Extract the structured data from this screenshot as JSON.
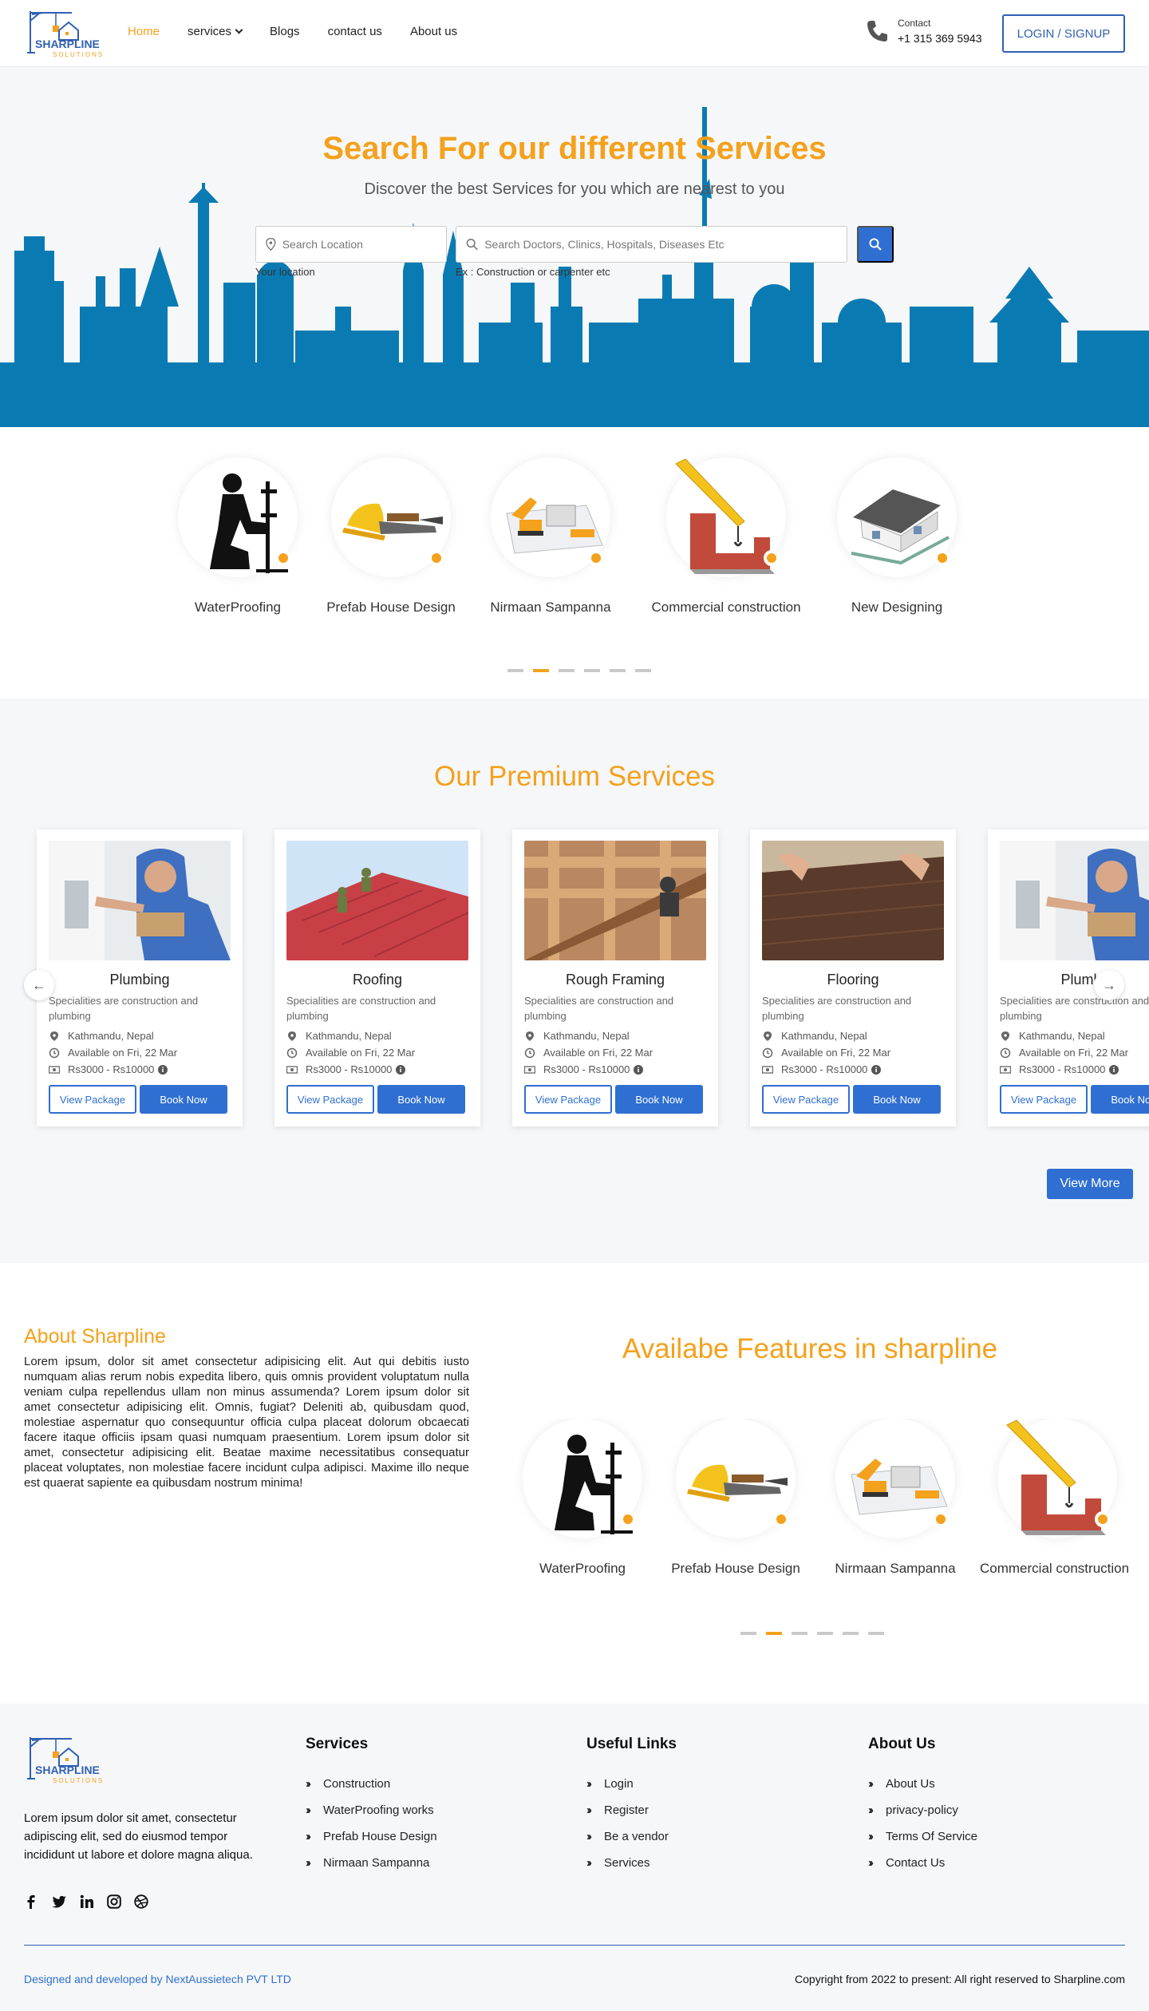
{
  "header": {
    "logo_text": "SHARPLINE",
    "logo_sub": "SOLUTIONS",
    "nav": [
      "Home",
      "services",
      "Blogs",
      "contact us",
      "About us"
    ],
    "contact_label": "Contact",
    "contact_number": "+1 315 369 5943",
    "login_label": "LOGIN / SIGNUP"
  },
  "hero": {
    "title": "Search For our different Services",
    "subtitle": "Discover the best Services for you which are nearest to you",
    "location_placeholder": "Search Location",
    "service_placeholder": "Search Doctors, Clinics, Hospitals, Diseases Etc",
    "location_hint": "Your location",
    "service_hint": "Ex : Construction or carpenter etc",
    "skyline_color": "#0a7bb2"
  },
  "categories": {
    "items": [
      {
        "label": "WaterProofing",
        "icon": "worker-icon"
      },
      {
        "label": "Prefab House Design",
        "icon": "helmet-tools-icon"
      },
      {
        "label": "Nirmaan Sampanna",
        "icon": "excavator-plan-icon"
      },
      {
        "label": "Commercial construction",
        "icon": "crane-brick-icon"
      },
      {
        "label": "New Designing",
        "icon": "house-model-icon"
      }
    ]
  },
  "premium": {
    "title": "Our Premium Services",
    "cards": [
      {
        "title": "Plumbing",
        "desc": "Specialities are construction and plumbing",
        "location": "Kathmandu, Nepal",
        "availability": "Available on Fri, 22 Mar",
        "price": "Rs3000 - Rs10000",
        "view_label": "View Package",
        "book_label": "Book Now"
      },
      {
        "title": "Roofing",
        "desc": "Specialities are construction and plumbing",
        "location": "Kathmandu, Nepal",
        "availability": "Available on Fri, 22 Mar",
        "price": "Rs3000 - Rs10000",
        "view_label": "View Package",
        "book_label": "Book Now"
      },
      {
        "title": "Rough Framing",
        "desc": "Specialities are construction and plumbing",
        "location": "Kathmandu, Nepal",
        "availability": "Available on Fri, 22 Mar",
        "price": "Rs3000 - Rs10000",
        "view_label": "View Package",
        "book_label": "Book Now"
      },
      {
        "title": "Flooring",
        "desc": "Specialities are construction and plumbing",
        "location": "Kathmandu, Nepal",
        "availability": "Available on Fri, 22 Mar",
        "price": "Rs3000 - Rs10000",
        "view_label": "View Package",
        "book_label": "Book Now"
      },
      {
        "title": "Plumbing",
        "desc": "Specialities are construction and plumbing",
        "location": "Kathmandu, Nepal",
        "availability": "Available on Fri, 22 Mar",
        "price": "Rs3000 - Rs10000",
        "view_label": "View Package",
        "book_label": "Book Now"
      }
    ],
    "prev_arrow": "←",
    "next_arrow": "→",
    "view_more_label": "View More"
  },
  "about": {
    "title": "About Sharpline",
    "text": "Lorem ipsum, dolor sit amet consectetur adipisicing elit. Aut qui debitis iusto numquam alias rerum nobis expedita libero, quis omnis provident voluptatum nulla veniam culpa repellendus ullam non minus assumenda? Lorem ipsum dolor sit amet consectetur adipisicing elit. Omnis, fugiat? Deleniti ab, quibusdam quod, molestiae aspernatur quo consequuntur officia culpa placeat dolorum obcaecati facere itaque officiis ipsam quasi numquam praesentium. Lorem ipsum dolor sit amet, consectetur adipisicing elit. Beatae maxime necessitatibus consequatur placeat voluptates, non molestiae facere incidunt culpa adipisci. Maxime illo neque est quaerat sapiente ea quibusdam nostrum minima!",
    "features_title": "Availabe Features in sharpline",
    "features": [
      {
        "label": "WaterProofing",
        "icon": "worker-icon"
      },
      {
        "label": "Prefab House Design",
        "icon": "helmet-tools-icon"
      },
      {
        "label": "Nirmaan Sampanna",
        "icon": "excavator-plan-icon"
      },
      {
        "label": "Commercial construction",
        "icon": "crane-brick-icon"
      }
    ]
  },
  "footer": {
    "description": "Lorem ipsum dolor sit amet, consectetur adipiscing elit, sed do eiusmod tempor incididunt ut labore et dolore magna aliqua.",
    "services_title": "Services",
    "services": [
      "Construction",
      "WaterProofing works",
      "Prefab House Design",
      "Nirmaan Sampanna"
    ],
    "links_title": "Useful Links",
    "links": [
      "Login",
      "Register",
      "Be a vendor",
      "Services"
    ],
    "about_title": "About Us",
    "about_links": [
      "About Us",
      "privacy-policy",
      "Terms Of Service",
      "Contact Us"
    ],
    "social_icons": [
      "facebook-icon",
      "twitter-icon",
      "linkedin-icon",
      "instagram-icon",
      "dribbble-icon"
    ],
    "credit": "Designed and developed by NextAussietech PVT LTD",
    "copyright": "Copyright from 2022 to present: All right reserved to Sharpline.com"
  },
  "colors": {
    "accent": "#f4a11c",
    "primary": "#2f6fd1",
    "skyline": "#0a7bb2"
  }
}
